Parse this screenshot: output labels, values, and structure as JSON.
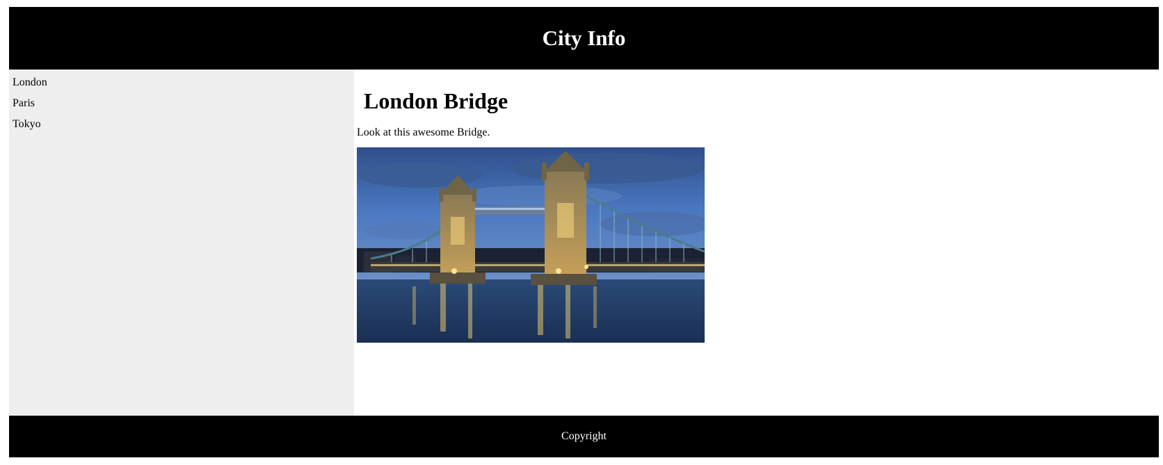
{
  "header": {
    "title": "City Info"
  },
  "sidebar": {
    "items": [
      {
        "label": "London"
      },
      {
        "label": "Paris"
      },
      {
        "label": "Tokyo"
      }
    ]
  },
  "main": {
    "heading": "London Bridge",
    "text": "Look at this awesome Bridge.",
    "image": {
      "subject": "tower-bridge-at-dusk"
    }
  },
  "footer": {
    "text": "Copyright"
  },
  "colors": {
    "header_bg": "#000000",
    "sidebar_bg": "#eeeeee",
    "footer_bg": "#000000",
    "text_light": "#ffffff"
  }
}
